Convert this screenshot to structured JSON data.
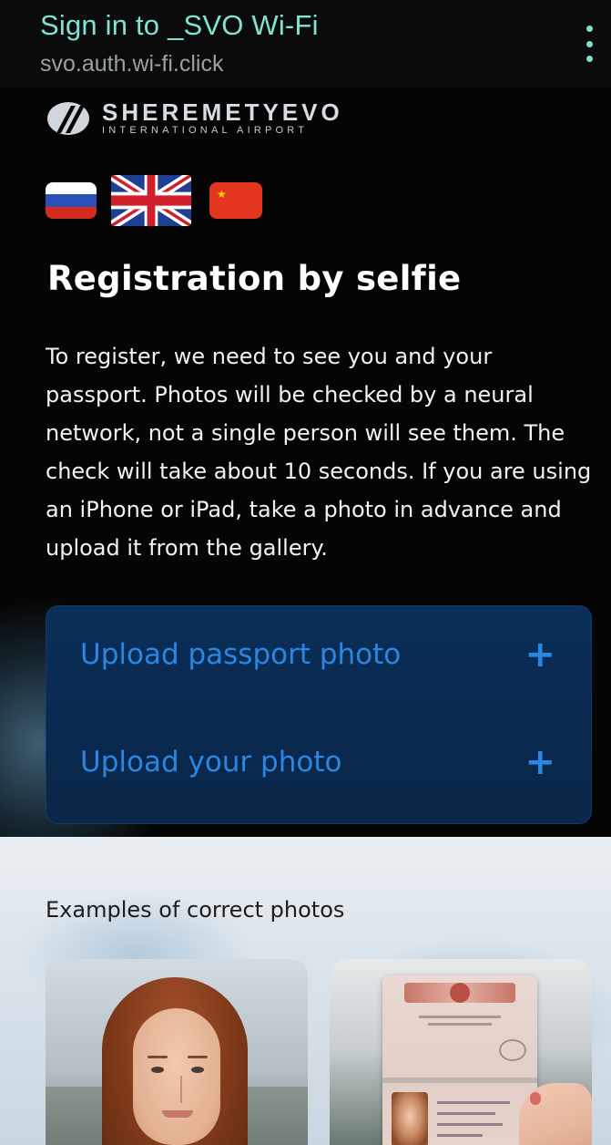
{
  "browser": {
    "title": "Sign in to _SVO Wi-Fi",
    "url": "svo.auth.wi-fi.click",
    "menu_icon": "more-vertical-icon"
  },
  "brand": {
    "name": "SHEREMETYEVO",
    "tagline": "INTERNATIONAL AIRPORT"
  },
  "languages": [
    {
      "name": "ru-flag-icon",
      "colors": [
        "#ffffff",
        "#2a4fb8",
        "#d52b1e"
      ]
    },
    {
      "name": "uk-flag-icon",
      "colors": [
        "#1f3f93",
        "#ffffff",
        "#d1202c"
      ]
    },
    {
      "name": "cn-flag-icon",
      "colors": [
        "#e4361f",
        "#f5d20a"
      ]
    }
  ],
  "main": {
    "heading": "Registration by selfie",
    "description": "To register, we need to see you and your passport. Photos will be checked by a neural network, not a single person will see them. The check will take about 10 seconds. If you are using an iPhone or iPad, take a photo in advance and upload it from the gallery."
  },
  "upload": {
    "passport_label": "Upload passport photo",
    "photo_label": "Upload your photo",
    "plus_symbol": "+"
  },
  "examples": {
    "title": "Examples of correct photos"
  },
  "colors": {
    "accent": "#2b86e2",
    "title": "#7fe3d4",
    "panel": "#0b2f58"
  }
}
